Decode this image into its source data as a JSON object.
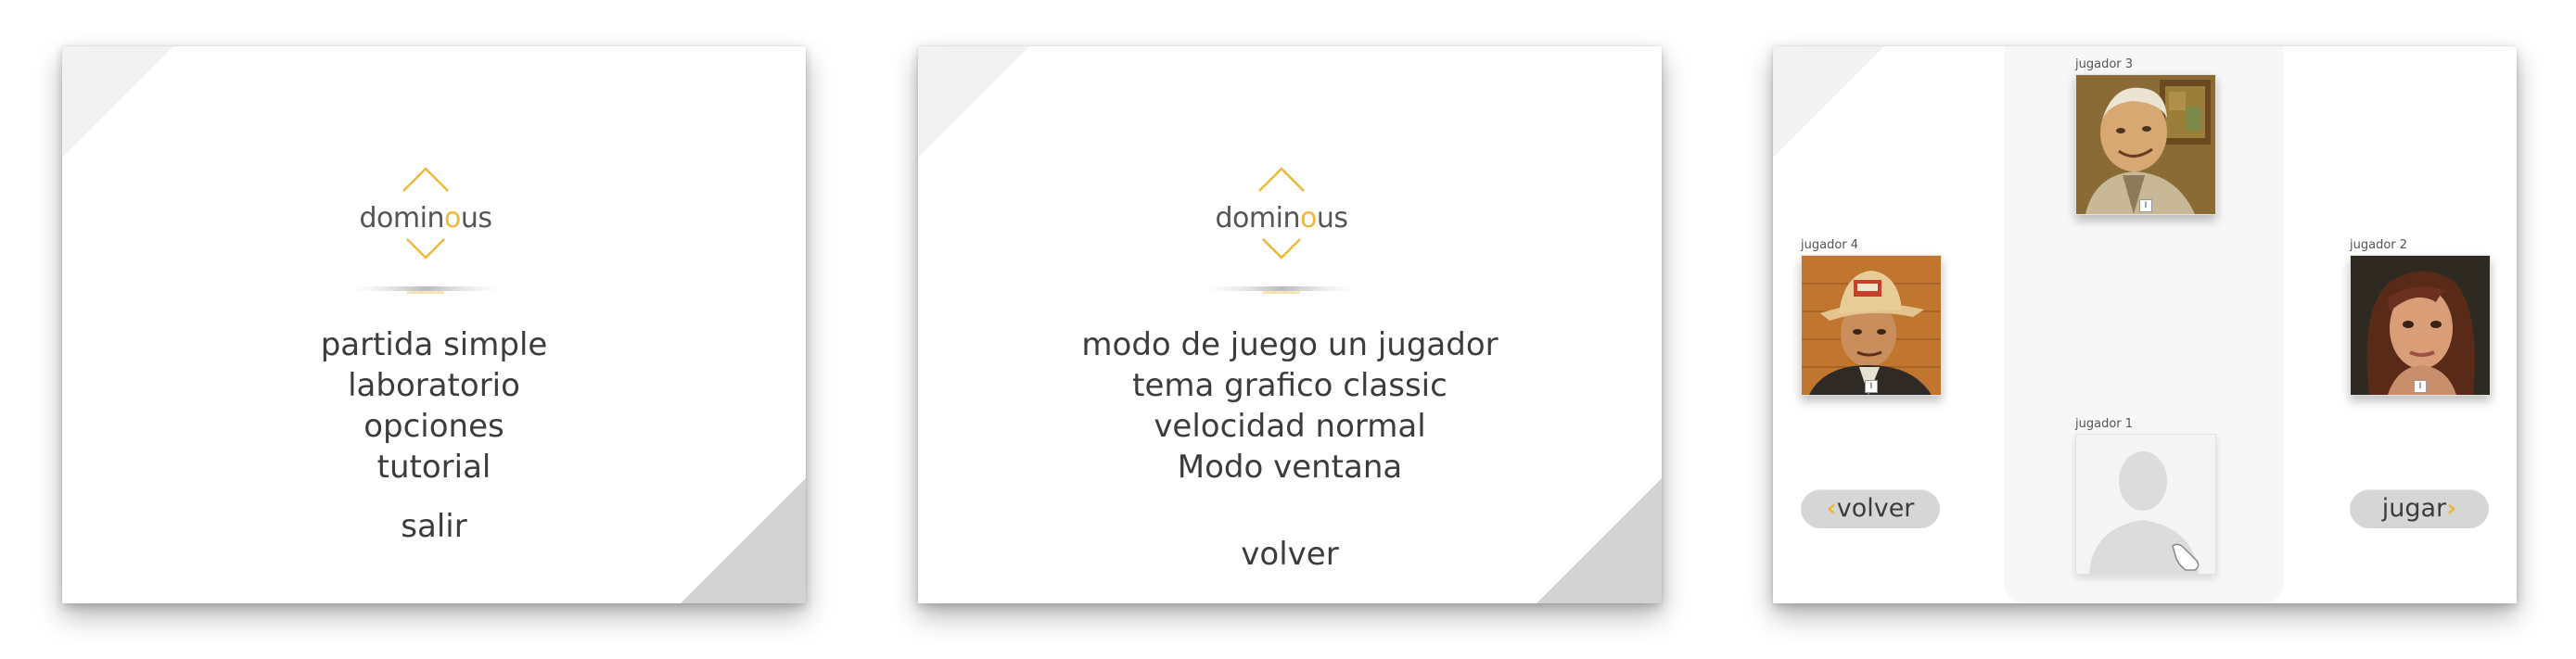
{
  "logo": {
    "text_pre": "domin",
    "text_accent": "o",
    "text_post": "us",
    "accent_color": "#f0b73a",
    "text_color": "#555555"
  },
  "main_menu": {
    "items": [
      "partida simple",
      "laboratorio",
      "opciones",
      "tutorial"
    ],
    "exit_label": "salir"
  },
  "options_menu": {
    "items": [
      "modo de juego un jugador",
      "tema grafico classic",
      "velocidad normal",
      "Modo ventana"
    ],
    "back_label": "volver"
  },
  "player_setup": {
    "players": {
      "p1": {
        "label": "jugador 1",
        "photo": "empty-silhouette"
      },
      "p2": {
        "label": "jugador 2",
        "photo": "woman-portrait",
        "badge": "I"
      },
      "p3": {
        "label": "jugador 3",
        "photo": "elderly-man-portrait",
        "badge": "I"
      },
      "p4": {
        "label": "jugador 4",
        "photo": "man-with-hat-portrait",
        "badge": "I"
      }
    },
    "back_button": {
      "chevron": "‹",
      "label": "volver"
    },
    "play_button": {
      "label": "jugar",
      "chevron": "›"
    }
  },
  "colors": {
    "panel_bg": "#ffffff",
    "corner_light": "#f2f2f2",
    "corner_dark": "#d2d2d2",
    "menu_text": "#3c3c3c",
    "pill_bg": "#d6d6d6",
    "accent": "#f0b73a"
  }
}
